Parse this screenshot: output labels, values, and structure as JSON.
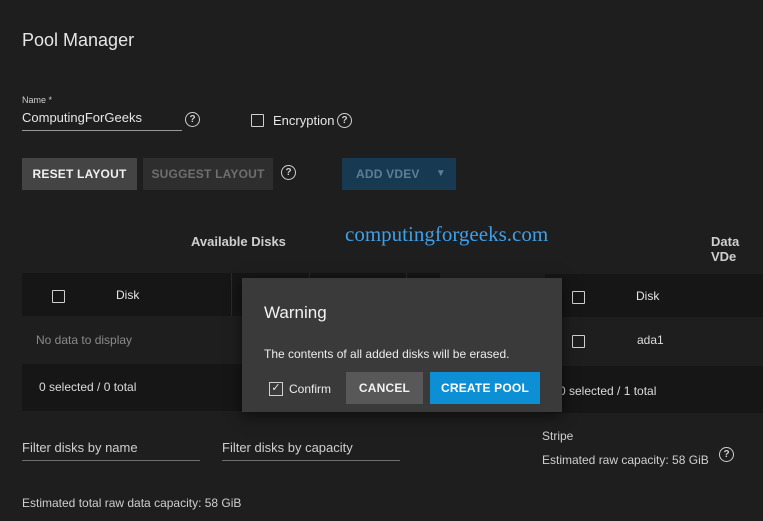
{
  "page": {
    "title": "Pool Manager"
  },
  "name_field": {
    "label": "Name *",
    "value": "ComputingForGeeks",
    "help_icon": "help-circle-icon"
  },
  "encryption": {
    "label": "Encryption",
    "checked": false,
    "help_icon": "help-circle-icon"
  },
  "toolbar": {
    "reset_label": "RESET LAYOUT",
    "suggest_label": "SUGGEST LAYOUT",
    "add_vdev_label": "ADD VDEV",
    "add_vdev_caret": "▼"
  },
  "watermark": "computingforgeeks.com",
  "available_disks": {
    "title": "Available Disks",
    "column_disk": "Disk",
    "empty_message": "No data to display",
    "footer": "0 selected / 0 total",
    "filter_name_placeholder": "Filter disks by name",
    "filter_capacity_placeholder": "Filter disks by capacity"
  },
  "data_vdevs": {
    "title": "Data VDe",
    "column_disk": "Disk",
    "rows": [
      {
        "disk": "ada1"
      }
    ],
    "footer": "0 selected / 1 total",
    "layout": "Stripe",
    "estimated_raw_capacity": "Estimated raw capacity: 58 GiB"
  },
  "estimated_total": "Estimated total raw data capacity: 58 GiB",
  "dialog": {
    "title": "Warning",
    "message": "The contents of all added disks will be erased.",
    "confirm_label": "Confirm",
    "confirm_checked": true,
    "confirm_mark": "✓",
    "cancel_label": "CANCEL",
    "create_label": "CREATE POOL"
  },
  "colors": {
    "background": "#1e1e1e",
    "primary_button": "#0d8fd6",
    "dialog_bg": "#3a3a3a",
    "watermark": "#3ea0e8"
  }
}
